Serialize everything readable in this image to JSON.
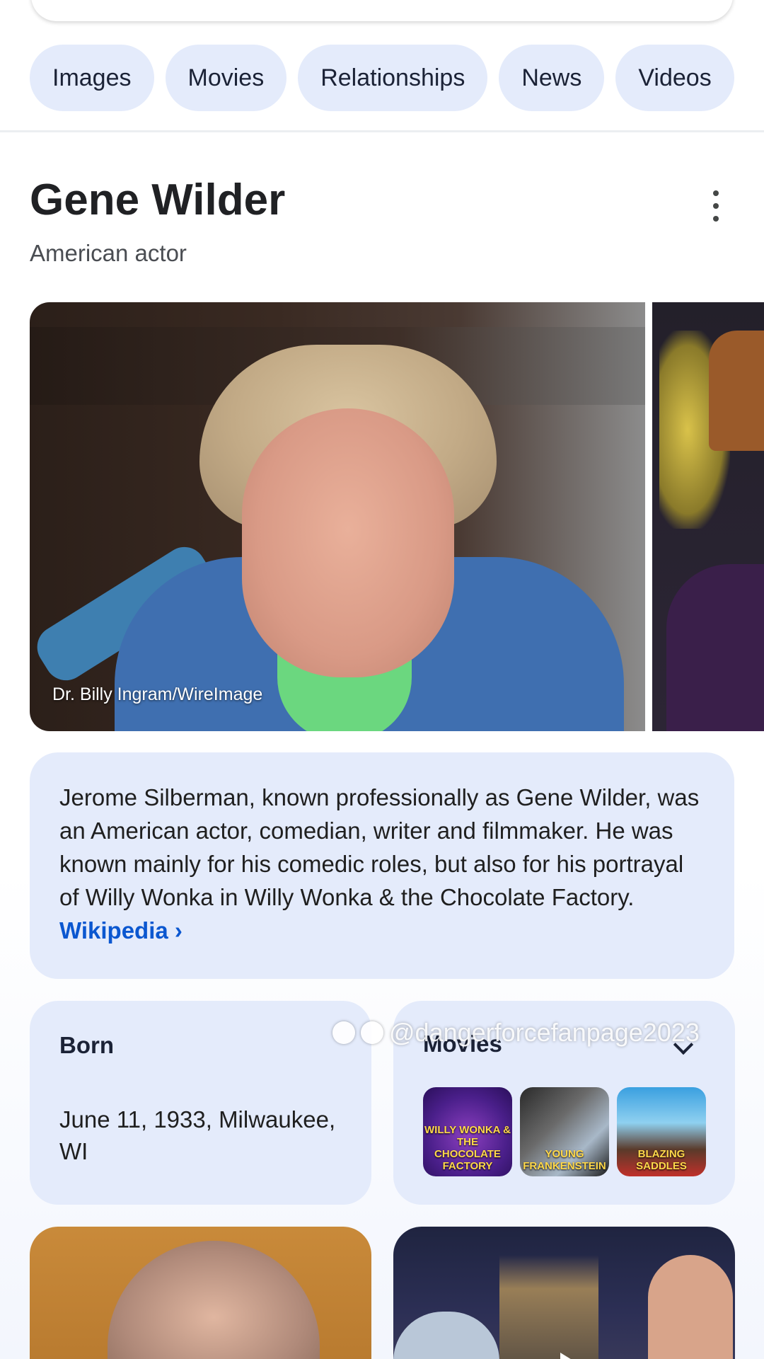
{
  "chips": [
    "Images",
    "Movies",
    "Relationships",
    "News",
    "Videos"
  ],
  "knowledge_panel": {
    "title": "Gene Wilder",
    "subtitle": "American actor",
    "image_credit": "Dr. Billy Ingram/WireImage",
    "description": "Jerome Silberman, known professionally as Gene Wilder, was an American actor, comedian, writer and filmmaker. He was known mainly for his comedic roles, but also for his portrayal of Willy Wonka in Willy Wonka & the Chocolate Factory.",
    "wiki_link": "Wikipedia ›"
  },
  "born": {
    "label": "Born",
    "value": "June 11, 1933, Milwaukee, WI"
  },
  "movies": {
    "label": "Movies",
    "posters": [
      "WILLY WONKA & THE CHOCOLATE FACTORY",
      "YOUNG FRANKENSTEIN",
      "BLAZING SADDLES"
    ]
  },
  "watermark": "@dangerforcefanpage2023",
  "colors": {
    "chip_bg": "#e4ebfb",
    "card_bg": "#e4ebfb",
    "link": "#0b57d0"
  }
}
